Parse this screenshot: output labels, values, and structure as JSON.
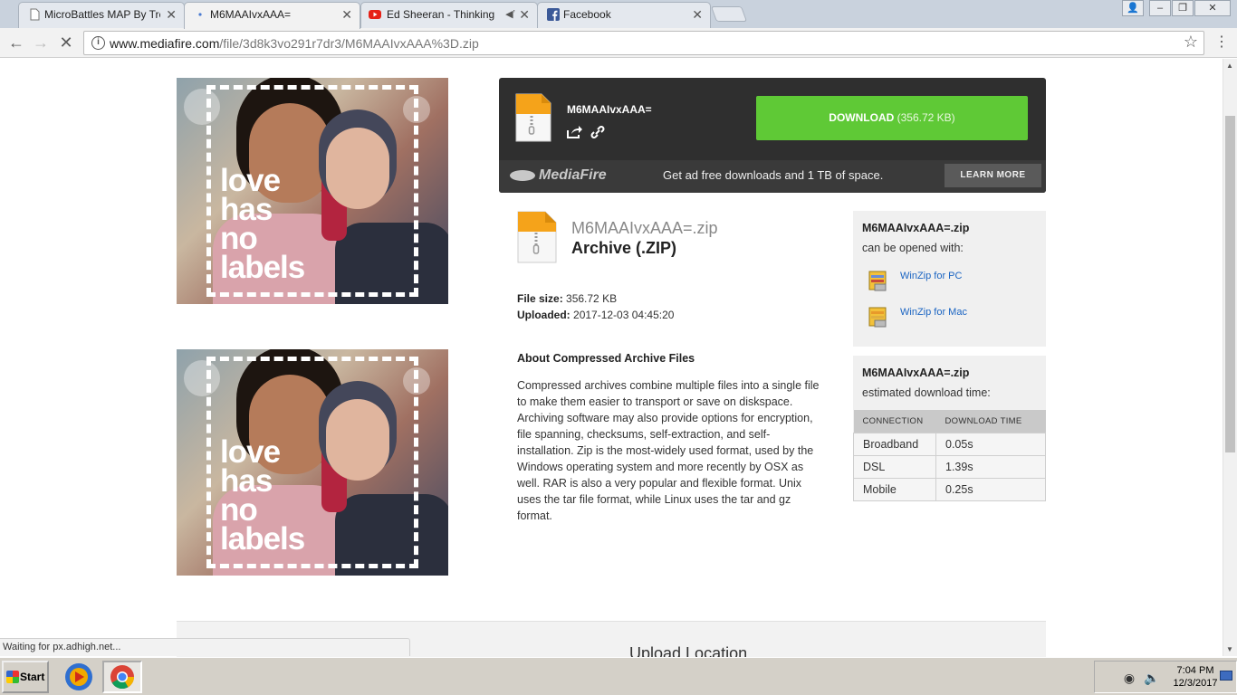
{
  "browser": {
    "tabs": [
      {
        "label": "MicroBattles MAP By Trenzk",
        "active": false,
        "icon": "page-icon"
      },
      {
        "label": "M6MAAIvxAAA=",
        "active": true,
        "icon": "loading-icon"
      },
      {
        "label": "Ed Sheeran - Thinking O",
        "active": false,
        "icon": "youtube-icon"
      },
      {
        "label": "Facebook",
        "active": false,
        "icon": "facebook-icon"
      }
    ],
    "url_host": "www.mediafire.com",
    "url_path": "/file/3d8k3vo291r7dr3/M6MAAIvxAAA%3D.zip",
    "status_text": "Waiting for px.adhigh.net..."
  },
  "ads": {
    "slogan": [
      "love",
      "has",
      "no",
      "labels"
    ]
  },
  "download": {
    "file_name": "M6MAAIvxAAA=",
    "button_label": "DOWNLOAD",
    "button_size": "(356.72 KB)",
    "brand": "MediaFire",
    "promo_text": "Get ad free downloads and 1 TB of space.",
    "learn_more": "LEARN MORE"
  },
  "file": {
    "full_name": "M6MAAIvxAAA=.zip",
    "type": "Archive (.ZIP)",
    "size_label": "File size:",
    "size_value": "356.72 KB",
    "uploaded_label": "Uploaded:",
    "uploaded_value": "2017-12-03 04:45:20"
  },
  "about": {
    "heading": "About Compressed Archive Files",
    "text": "Compressed archives combine multiple files into a single file to make them easier to transport or save on diskspace. Archiving software may also provide options for encryption, file spanning, checksums, self-extraction, and self-installation. Zip is the most-widely used format, used by the Windows operating system and more recently by OSX as well. RAR is also a very popular and flexible format. Unix uses the tar file format, while Linux uses the tar and gz format."
  },
  "opened_with": {
    "title": "M6MAAIvxAAA=.zip",
    "subtitle": "can be opened with:",
    "apps": [
      "WinZip for PC",
      "WinZip for Mac"
    ]
  },
  "download_time": {
    "title": "M6MAAIvxAAA=.zip",
    "subtitle": "estimated download time:",
    "headers": [
      "CONNECTION",
      "DOWNLOAD TIME"
    ],
    "rows": [
      {
        "connection": "Broadband",
        "time": "0.05s"
      },
      {
        "connection": "DSL",
        "time": "1.39s"
      },
      {
        "connection": "Mobile",
        "time": "0.25s"
      }
    ]
  },
  "lower": {
    "heading": "Upload Location"
  },
  "taskbar": {
    "start_label": "Start",
    "time": "7:04 PM",
    "date": "12/3/2017"
  },
  "colors": {
    "download_green": "#5fc936",
    "dark_panel": "#2f2f2f",
    "link_blue": "#1a64c2",
    "file_orange": "#f5a31a"
  }
}
